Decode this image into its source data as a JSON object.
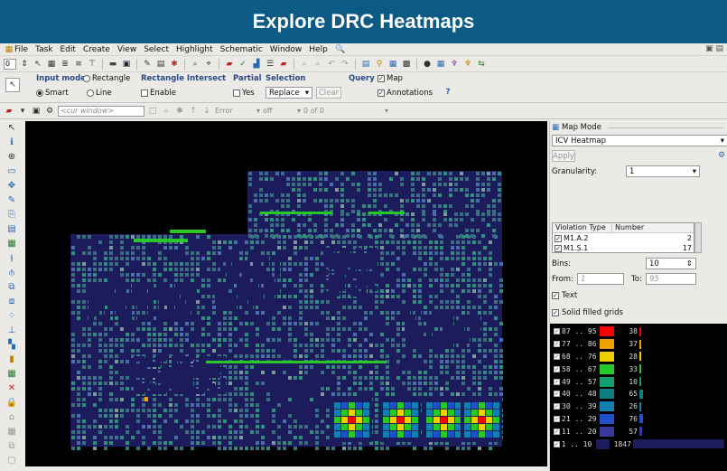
{
  "banner": {
    "title": "Explore DRC Heatmaps"
  },
  "menubar": {
    "items": [
      "File",
      "Task",
      "Edit",
      "Create",
      "View",
      "Select",
      "Highlight",
      "Schematic",
      "Window",
      "Help"
    ]
  },
  "toolbar1": {
    "layer_value": "0"
  },
  "modebar": {
    "input_mode_label": "Input mode",
    "rect_label": "Rectangle",
    "smart_label": "Smart",
    "line_label": "Line",
    "rect_intersect_label": "Rectangle Intersect",
    "enable_label": "Enable",
    "partial_label": "Partial",
    "yes_label": "Yes",
    "selection_label": "Selection",
    "replace_value": "Replace",
    "clear_label": "Clear",
    "query_label": "Query",
    "map_label": "Map",
    "annotations_label": "Annotations"
  },
  "toolbar2": {
    "window_placeholder": "<cur window>",
    "error_value": "Error",
    "off_value": "off",
    "count_value": "0 of 0"
  },
  "panel": {
    "title": "Map Mode",
    "mode_value": "ICV Heatmap",
    "apply_label": "Apply",
    "granularity_label": "Granularity:",
    "granularity_value": "1",
    "table_headers": [
      "Violation Type",
      "Number"
    ],
    "violations": [
      {
        "type": "M1.A.2",
        "number": "2"
      },
      {
        "type": "M1.S.1",
        "number": "17"
      }
    ],
    "bins_label": "Bins:",
    "bins_value": "10",
    "from_label": "From:",
    "from_value": "1",
    "to_label": "To:",
    "to_value": "95",
    "text_label": "Text",
    "solid_label": "Solid filled grids"
  },
  "legend": [
    {
      "range": "87 .. 95",
      "color": "#ff0000",
      "count": "38",
      "bar_frac": 0.02
    },
    {
      "range": "77 .. 86",
      "color": "#f0a000",
      "count": "37",
      "bar_frac": 0.02
    },
    {
      "range": "68 .. 76",
      "color": "#f0d000",
      "count": "28",
      "bar_frac": 0.015
    },
    {
      "range": "58 .. 67",
      "color": "#28c828",
      "count": "33",
      "bar_frac": 0.018
    },
    {
      "range": "49 .. 57",
      "color": "#10a070",
      "count": "10",
      "bar_frac": 0.006
    },
    {
      "range": "40 .. 48",
      "color": "#0e7f80",
      "count": "65",
      "bar_frac": 0.035
    },
    {
      "range": "30 .. 39",
      "color": "#1080b0",
      "count": "26",
      "bar_frac": 0.014
    },
    {
      "range": "21 .. 29",
      "color": "#2050c8",
      "count": "76",
      "bar_frac": 0.04
    },
    {
      "range": "11 .. 20",
      "color": "#3a3a9a",
      "count": "57",
      "bar_frac": 0.03
    },
    {
      "range": "1 .. 10",
      "color": "#1c1c5c",
      "count": "1847",
      "bar_frac": 1.0
    }
  ]
}
